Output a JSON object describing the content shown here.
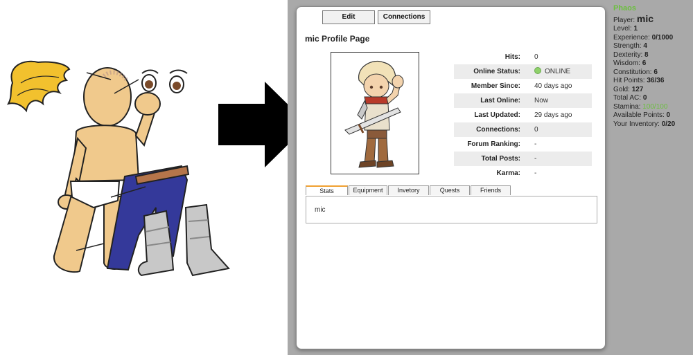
{
  "buttons": {
    "edit": "Edit",
    "connections": "Connections"
  },
  "page_title": "mic Profile Page",
  "profile_rows": [
    {
      "label": "Hits:",
      "value": "0"
    },
    {
      "label": "Online Status:",
      "value": "ONLINE"
    },
    {
      "label": "Member Since:",
      "value": "40 days ago"
    },
    {
      "label": "Last Online:",
      "value": "Now"
    },
    {
      "label": "Last Updated:",
      "value": "29 days ago"
    },
    {
      "label": "Connections:",
      "value": "0"
    },
    {
      "label": "Forum Ranking:",
      "value": "-"
    },
    {
      "label": "Total Posts:",
      "value": "-"
    },
    {
      "label": "Karma:",
      "value": "-"
    }
  ],
  "tabs": [
    "Stats",
    "Equipment",
    "Invetory",
    "Quests",
    "Friends"
  ],
  "active_tab": "Stats",
  "tab_content": "mic",
  "sidebar": {
    "game": "Phaos",
    "player_label": "Player:",
    "player_name": "mic",
    "stats": [
      {
        "label": "Level:",
        "value": "1"
      },
      {
        "label": "Experience:",
        "value": "0/1000"
      },
      {
        "label": "Strength:",
        "value": "4"
      },
      {
        "label": "Dexterity:",
        "value": "8"
      },
      {
        "label": "Wisdom:",
        "value": "6"
      },
      {
        "label": "Constitution:",
        "value": "6"
      },
      {
        "label": "Hit Points:",
        "value": "36/36"
      },
      {
        "label": "Gold:",
        "value": "127"
      },
      {
        "label": "Total AC:",
        "value": "0"
      },
      {
        "label": "Stamina:",
        "value": "100/100"
      },
      {
        "label": "Available Points:",
        "value": "0"
      },
      {
        "label": "Your Inventory:",
        "value": "0/20"
      }
    ]
  },
  "colors": {
    "online": "#6cbf3f",
    "page_bg": "#a9a9a9",
    "tab_accent": "#f0a030"
  }
}
